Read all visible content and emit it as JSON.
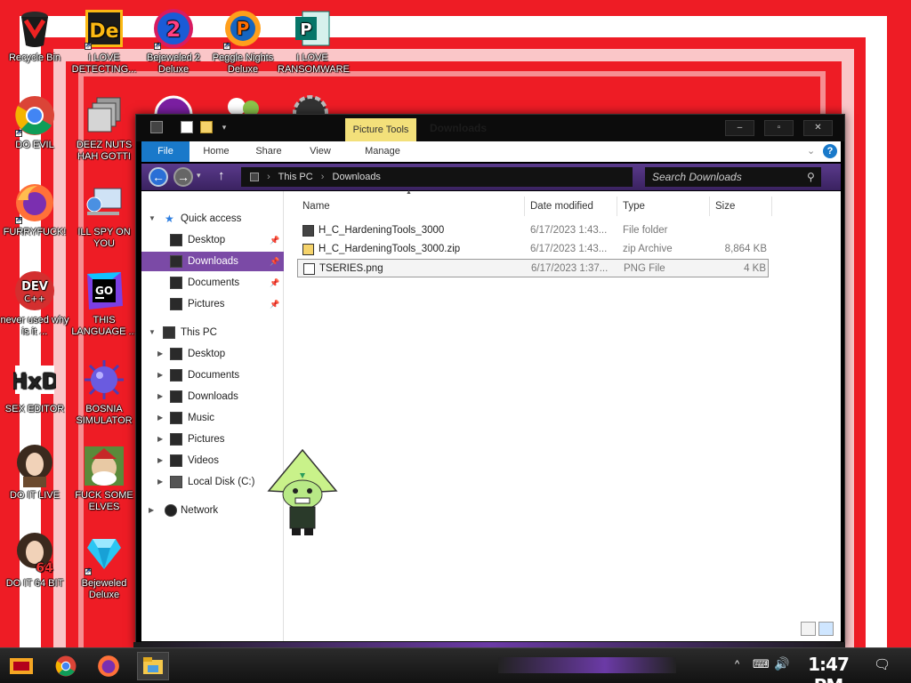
{
  "desktop_icons": [
    {
      "label": "Recycle Bin",
      "icon": "recycle-bin-icon"
    },
    {
      "label": "I LOVE DETECTING...",
      "icon": "de-app-icon"
    },
    {
      "label": "Bejeweled 2 Deluxe",
      "icon": "bejeweled2-icon"
    },
    {
      "label": "Peggle Nights Deluxe",
      "icon": "peggle-icon"
    },
    {
      "label": "I LOVE RANSOMWARE",
      "icon": "publisher-icon"
    },
    {
      "label": "DO EVIL",
      "icon": "chrome-icon"
    },
    {
      "label": "DEEZ NUTS HAH GOTTI",
      "icon": "stacked-windows-icon"
    },
    {
      "label": "FURRYFUCK!",
      "icon": "firefox-icon"
    },
    {
      "label": "ILL SPY ON YOU",
      "icon": "network-monitor-icon"
    },
    {
      "label": "never used why is it ...",
      "icon": "devcpp-icon"
    },
    {
      "label": "THIS LANGUAGE ...",
      "icon": "goland-icon"
    },
    {
      "label": "SEX EDITOR",
      "icon": "hxd-icon"
    },
    {
      "label": "BOSNIA SIMULATOR",
      "icon": "spiked-ball-icon"
    },
    {
      "label": "DO IT LIVE",
      "icon": "portrait-icon"
    },
    {
      "label": "FUCK SOME ELVES",
      "icon": "santa-icon"
    },
    {
      "label": "DO IT 64 BIT",
      "icon": "portrait-64-icon"
    },
    {
      "label": "Bejeweled Deluxe",
      "icon": "diamond-icon"
    }
  ],
  "window": {
    "title": "Downloads",
    "contextual_tab": "Picture Tools",
    "buttons": {
      "minimize": "‒",
      "maximize": "▫",
      "close": "✕"
    },
    "ribbon_tabs": [
      "File",
      "Home",
      "Share",
      "View",
      "Manage"
    ],
    "address": {
      "path": [
        "This PC",
        "Downloads"
      ],
      "separator": "›"
    },
    "search_placeholder": "Search Downloads",
    "columns": [
      "Name",
      "Date modified",
      "Type",
      "Size"
    ],
    "files": [
      {
        "name": "H_C_HardeningTools_3000",
        "date": "6/17/2023 1:43...",
        "type": "File folder",
        "size": ""
      },
      {
        "name": "H_C_HardeningTools_3000.zip",
        "date": "6/17/2023 1:43...",
        "type": "zip Archive",
        "size": "8,864 KB"
      },
      {
        "name": "TSERIES.png",
        "date": "6/17/2023 1:37...",
        "type": "PNG File",
        "size": "4 KB"
      }
    ],
    "nav": {
      "quick_access": {
        "label": "Quick access",
        "items": [
          "Desktop",
          "Downloads",
          "Documents",
          "Pictures"
        ]
      },
      "this_pc": {
        "label": "This PC",
        "items": [
          "Desktop",
          "Documents",
          "Downloads",
          "Music",
          "Pictures",
          "Videos",
          "Local Disk (C:)"
        ]
      },
      "network": {
        "label": "Network"
      }
    },
    "selected_nav": "Downloads"
  },
  "taskbar": {
    "clock": "1:47 PM",
    "pinned": [
      "start-icon",
      "chrome-icon",
      "firefox-icon",
      "explorer-icon"
    ]
  },
  "colors": {
    "wallpaper": "#ee1c25",
    "accent": "#7b4aa6",
    "file_tab": "#1979ca",
    "picture_tools": "#f3e07a"
  }
}
